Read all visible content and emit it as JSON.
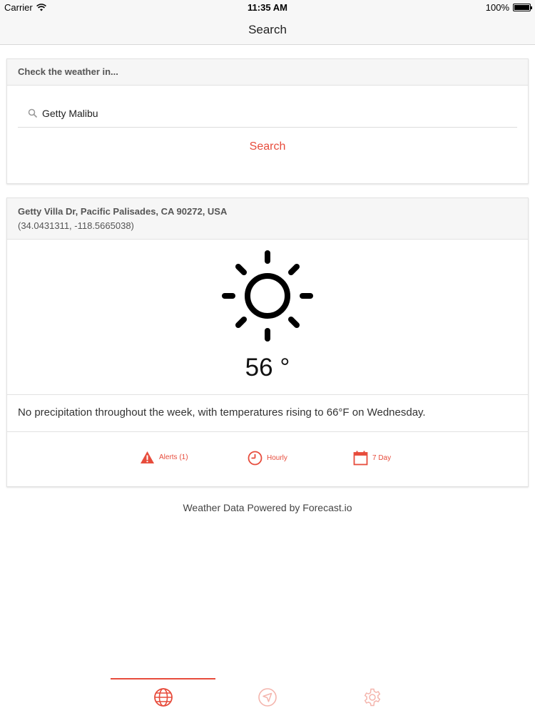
{
  "status_bar": {
    "carrier": "Carrier",
    "time": "11:35 AM",
    "battery": "100%",
    "battery_level": 1.0
  },
  "nav": {
    "title": "Search"
  },
  "search_card": {
    "header": "Check the weather in...",
    "input_value": "Getty Malibu",
    "button_label": "Search"
  },
  "result_card": {
    "address": "Getty Villa Dr, Pacific Palisades, CA 90272, USA",
    "coordinates": "(34.0431311, -118.5665038)",
    "icon": "sun-icon",
    "temperature": "56 °",
    "summary": "No precipitation throughout the week, with temperatures rising to 66°F on Wednesday.",
    "actions": [
      {
        "label": "Alerts (1)",
        "icon": "alert-triangle-icon"
      },
      {
        "label": "Hourly",
        "icon": "clock-icon"
      },
      {
        "label": "7 Day",
        "icon": "calendar-icon"
      }
    ]
  },
  "footer": {
    "powered_by": "Weather Data Powered by Forecast.io"
  },
  "tab_bar": {
    "tabs": [
      {
        "icon": "globe-icon",
        "active": true
      },
      {
        "icon": "location-arrow-icon",
        "active": false
      },
      {
        "icon": "gear-icon",
        "active": false
      }
    ]
  },
  "colors": {
    "accent": "#e74c3c",
    "header_bg": "#f6f6f6",
    "inactive_icon": "#f4b5ad"
  }
}
